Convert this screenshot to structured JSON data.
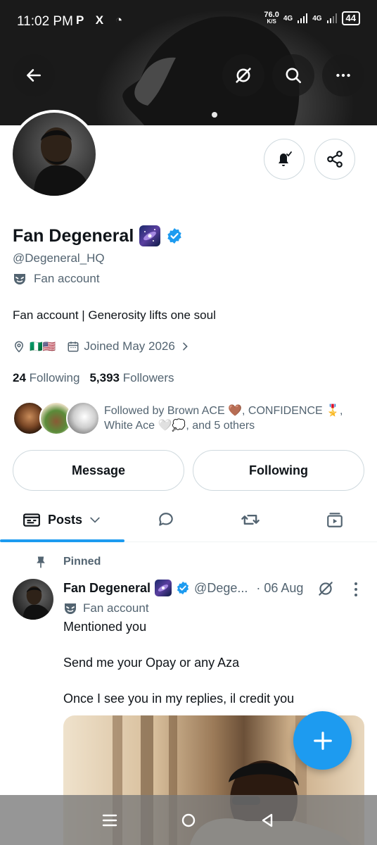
{
  "status_bar": {
    "time": "11:02 PM",
    "app_icons": "P X ◔",
    "net_speed": "76.0",
    "net_unit": "K/S",
    "network": "4G",
    "network2": "4G",
    "battery": "44"
  },
  "profile": {
    "name": "Fan Degeneral",
    "handle": "@Degeneral_HQ",
    "label": "Fan account",
    "bio": "Fan account | Generosity lifts one soul",
    "location_flags": "🇳🇬🇺🇸",
    "joined": "Joined May 2026",
    "following_count": "24",
    "following_label": "Following",
    "followers_count": "5,393",
    "followers_label": "Followers",
    "followed_by": "Followed by Brown ACE 🤎, CONFIDENCE 🎖️, White Ace 🤍💭, and 5 others"
  },
  "actions": {
    "message": "Message",
    "following": "Following"
  },
  "tabs": {
    "posts": "Posts"
  },
  "post": {
    "pinned": "Pinned",
    "name": "Fan Degeneral",
    "handle": "@Dege...",
    "date": "· 06 Aug",
    "label": "Fan account",
    "line1": "Mentioned you",
    "line2": "Send me your Opay or any Aza",
    "line3": "Once I see you in my replies, il credit you"
  },
  "colors": {
    "accent": "#1d9bf0",
    "text": "#0f1419",
    "muted": "#536471",
    "border": "#cfd9de"
  }
}
